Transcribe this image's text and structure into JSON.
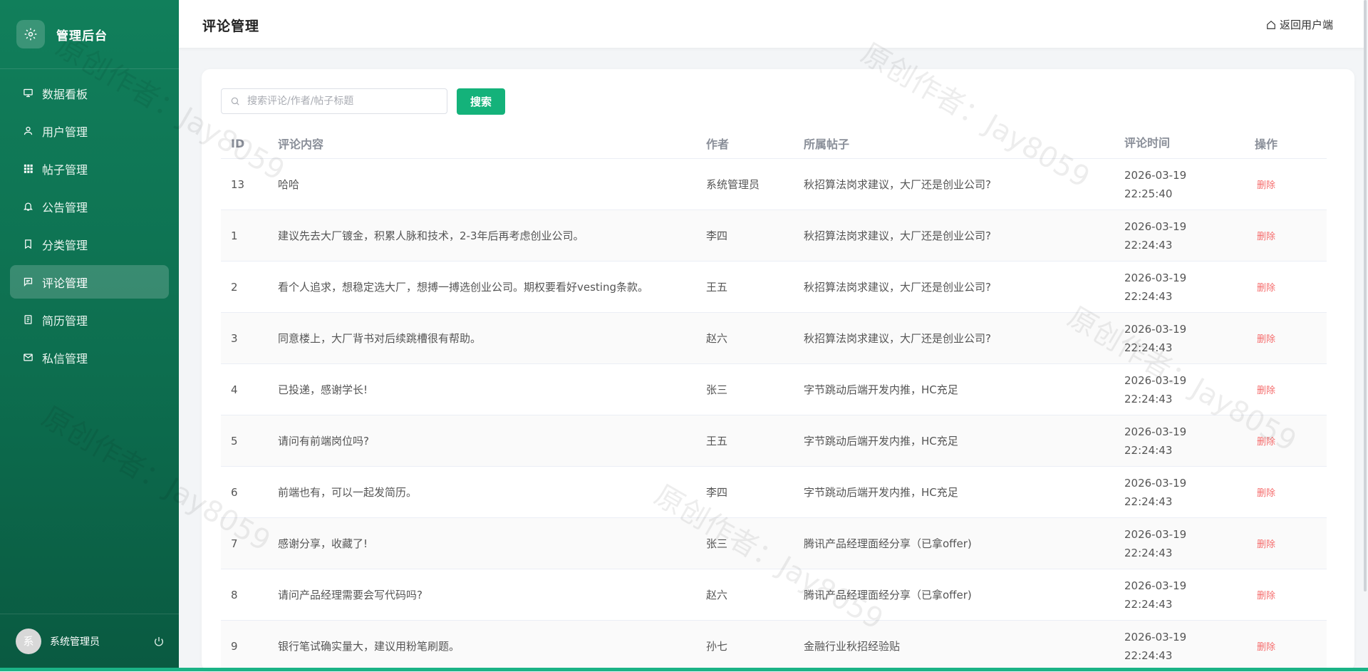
{
  "sidebar": {
    "brand": "管理后台",
    "items": [
      {
        "label": "数据看板",
        "icon": "dashboard-icon"
      },
      {
        "label": "用户管理",
        "icon": "user-icon"
      },
      {
        "label": "帖子管理",
        "icon": "grid-icon"
      },
      {
        "label": "公告管理",
        "icon": "bell-icon"
      },
      {
        "label": "分类管理",
        "icon": "bookmark-icon"
      },
      {
        "label": "评论管理",
        "icon": "comment-icon",
        "active": true
      },
      {
        "label": "简历管理",
        "icon": "document-icon"
      },
      {
        "label": "私信管理",
        "icon": "mail-icon"
      }
    ],
    "user": {
      "avatar_text": "系",
      "name": "系统管理员"
    }
  },
  "header": {
    "title": "评论管理",
    "back_label": "返回用户端"
  },
  "search": {
    "placeholder": "搜索评论/作者/帖子标题",
    "value": "",
    "button_label": "搜索"
  },
  "table": {
    "columns": [
      "ID",
      "评论内容",
      "作者",
      "所属帖子",
      "评论时间",
      "操作"
    ],
    "rows": [
      {
        "id": "13",
        "content": "哈哈",
        "author": "系统管理员",
        "post": "秋招算法岗求建议，大厂还是创业公司?",
        "date": "2026-03-19",
        "time": "22:25:40",
        "action": "删除"
      },
      {
        "id": "1",
        "content": "建议先去大厂镀金，积累人脉和技术，2-3年后再考虑创业公司。",
        "author": "李四",
        "post": "秋招算法岗求建议，大厂还是创业公司?",
        "date": "2026-03-19",
        "time": "22:24:43",
        "action": "删除"
      },
      {
        "id": "2",
        "content": "看个人追求，想稳定选大厂，想搏一搏选创业公司。期权要看好vesting条款。",
        "author": "王五",
        "post": "秋招算法岗求建议，大厂还是创业公司?",
        "date": "2026-03-19",
        "time": "22:24:43",
        "action": "删除"
      },
      {
        "id": "3",
        "content": "同意楼上，大厂背书对后续跳槽很有帮助。",
        "author": "赵六",
        "post": "秋招算法岗求建议，大厂还是创业公司?",
        "date": "2026-03-19",
        "time": "22:24:43",
        "action": "删除"
      },
      {
        "id": "4",
        "content": "已投递，感谢学长!",
        "author": "张三",
        "post": "字节跳动后端开发内推，HC充足",
        "date": "2026-03-19",
        "time": "22:24:43",
        "action": "删除"
      },
      {
        "id": "5",
        "content": "请问有前端岗位吗?",
        "author": "王五",
        "post": "字节跳动后端开发内推，HC充足",
        "date": "2026-03-19",
        "time": "22:24:43",
        "action": "删除"
      },
      {
        "id": "6",
        "content": "前端也有，可以一起发简历。",
        "author": "李四",
        "post": "字节跳动后端开发内推，HC充足",
        "date": "2026-03-19",
        "time": "22:24:43",
        "action": "删除"
      },
      {
        "id": "7",
        "content": "感谢分享，收藏了!",
        "author": "张三",
        "post": "腾讯产品经理面经分享（已拿offer)",
        "date": "2026-03-19",
        "time": "22:24:43",
        "action": "删除"
      },
      {
        "id": "8",
        "content": "请问产品经理需要会写代码吗?",
        "author": "赵六",
        "post": "腾讯产品经理面经分享（已拿offer)",
        "date": "2026-03-19",
        "time": "22:24:43",
        "action": "删除"
      },
      {
        "id": "9",
        "content": "银行笔试确实量大，建议用粉笔刷题。",
        "author": "孙七",
        "post": "金融行业秋招经验贴",
        "date": "2026-03-19",
        "time": "22:24:43",
        "action": "删除"
      }
    ]
  },
  "watermark": "原创作者：Jay8059",
  "colors": {
    "accent": "#14b27a",
    "sidebar": "#0d6e4f",
    "danger": "#f56c6c"
  }
}
